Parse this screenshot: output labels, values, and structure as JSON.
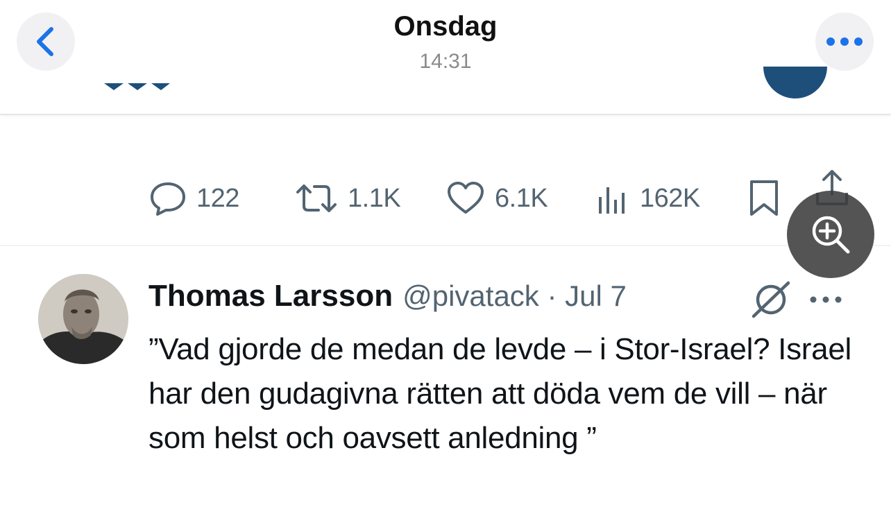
{
  "header": {
    "title": "Onsdag",
    "time": "14:31",
    "back_icon": "chevron-left-icon",
    "more_icon": "ellipsis-icon",
    "accent_color": "#1a73e8"
  },
  "tweet_actions": {
    "replies": "122",
    "retweets": "1.1K",
    "likes": "6.1K",
    "views": "162K"
  },
  "zoom_button": {
    "icon": "zoom-in-icon"
  },
  "tweet": {
    "author": "Thomas Larsson",
    "handle_date": "@pivatack · Jul 7",
    "text": "”Vad gjorde de medan de levde – i Stor-Israel? Israel har den gudagivna rätten att döda vem de vill – när som helst och oavsett anledning ”"
  },
  "colors": {
    "text_primary": "#0f1419",
    "text_secondary": "#536471"
  }
}
